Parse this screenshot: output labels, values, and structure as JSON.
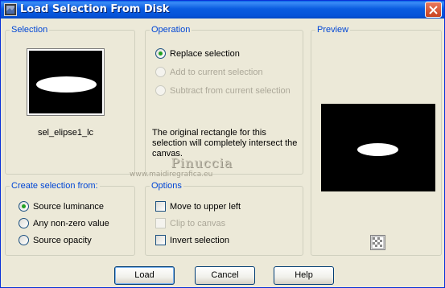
{
  "window": {
    "title": "Load Selection From Disk"
  },
  "selection": {
    "legend": "Selection",
    "file_name": "sel_elipse1_lc"
  },
  "operation": {
    "legend": "Operation",
    "options": [
      {
        "label": "Replace selection",
        "checked": true,
        "enabled": true
      },
      {
        "label": "Add to current selection",
        "checked": false,
        "enabled": false
      },
      {
        "label": "Subtract from current selection",
        "checked": false,
        "enabled": false
      }
    ],
    "info": "The original rectangle for this selection will completely intersect the canvas."
  },
  "preview": {
    "legend": "Preview"
  },
  "create_from": {
    "legend": "Create selection from:",
    "options": [
      {
        "label": "Source luminance",
        "checked": true
      },
      {
        "label": "Any non-zero value",
        "checked": false
      },
      {
        "label": "Source opacity",
        "checked": false
      }
    ]
  },
  "options": {
    "legend": "Options",
    "items": [
      {
        "label": "Move to upper left",
        "checked": false,
        "enabled": true
      },
      {
        "label": "Clip to canvas",
        "checked": false,
        "enabled": false
      },
      {
        "label": "Invert selection",
        "checked": false,
        "enabled": true
      }
    ]
  },
  "watermark": {
    "name": "Pinuccia",
    "url": "www.maidiregrafica.eu"
  },
  "buttons": {
    "load": "Load",
    "cancel": "Cancel",
    "help": "Help"
  },
  "colors": {
    "title_bar": "#0a5ce0",
    "legend_text": "#0046d5",
    "window_bg": "#ece9d8",
    "radio_dot": "#21a121"
  }
}
